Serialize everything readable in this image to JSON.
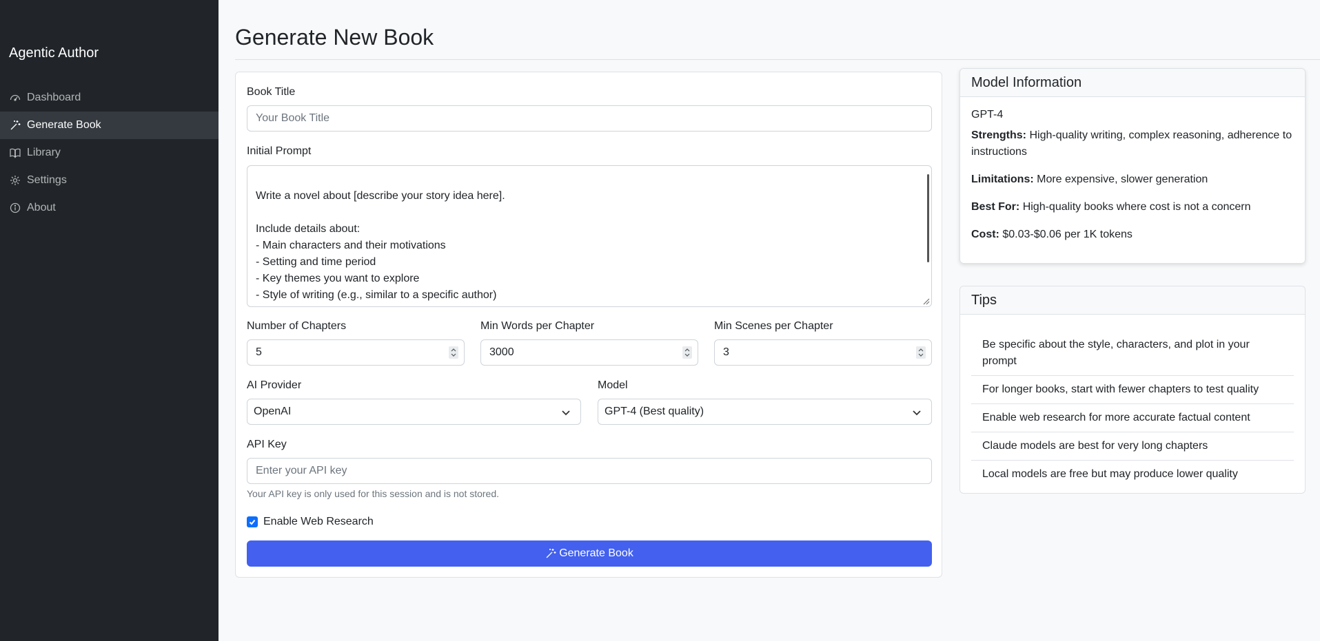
{
  "sidebar": {
    "brand": "Agentic Author",
    "items": [
      {
        "label": "Dashboard",
        "icon": "dashboard-icon",
        "active": false
      },
      {
        "label": "Generate Book",
        "icon": "magic-wand-icon",
        "active": true
      },
      {
        "label": "Library",
        "icon": "book-icon",
        "active": false
      },
      {
        "label": "Settings",
        "icon": "gear-icon",
        "active": false
      },
      {
        "label": "About",
        "icon": "info-icon",
        "active": false
      }
    ]
  },
  "page": {
    "title": "Generate New Book"
  },
  "form": {
    "title_label": "Book Title",
    "title_placeholder": "Your Book Title",
    "prompt_label": "Initial Prompt",
    "prompt_value": "Write a novel about [describe your story idea here].\n\nInclude details about:\n- Main characters and their motivations\n- Setting and time period\n- Key themes you want to explore\n- Style of writing (e.g., similar to a specific author)\n- Any specific plot elements you want included",
    "chapters_label": "Number of Chapters",
    "chapters_value": "5",
    "words_label": "Min Words per Chapter",
    "words_value": "3000",
    "scenes_label": "Min Scenes per Chapter",
    "scenes_value": "3",
    "provider_label": "AI Provider",
    "provider_value": "OpenAI",
    "model_label": "Model",
    "model_value": "GPT-4 (Best quality)",
    "api_key_label": "API Key",
    "api_key_placeholder": "Enter your API key",
    "api_key_help": "Your API key is only used for this session and is not stored.",
    "web_research_label": "Enable Web Research",
    "web_research_checked": true,
    "generate_label": "Generate Book"
  },
  "model_info": {
    "header": "Model Information",
    "name": "GPT-4",
    "strengths_label": "Strengths:",
    "strengths": "High-quality writing, complex reasoning, adherence to instructions",
    "limitations_label": "Limitations:",
    "limitations": "More expensive, slower generation",
    "best_for_label": "Best For:",
    "best_for": "High-quality books where cost is not a concern",
    "cost_label": "Cost:",
    "cost": "$0.03-$0.06 per 1K tokens"
  },
  "tips": {
    "header": "Tips",
    "items": [
      "Be specific about the style, characters, and plot in your prompt",
      "For longer books, start with fewer chapters to test quality",
      "Enable web research for more accurate factual content",
      "Claude models are best for very long chapters",
      "Local models are free but may produce lower quality"
    ]
  },
  "colors": {
    "sidebar_bg": "#212529",
    "primary_button": "#4361ee",
    "checkbox": "#0d6efd"
  }
}
